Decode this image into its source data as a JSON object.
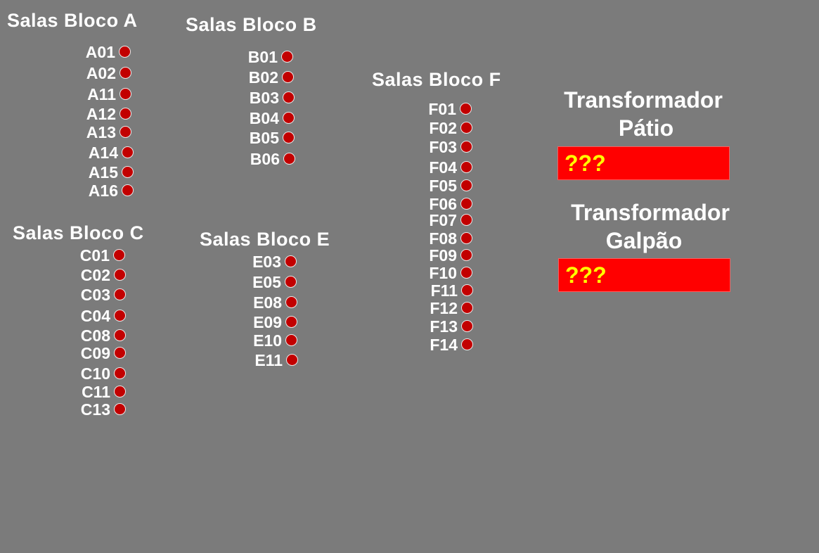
{
  "blocks": {
    "a": {
      "title": "Salas Bloco A",
      "rooms": [
        "A01",
        "A02",
        "A11",
        "A12",
        "A13",
        "A14",
        "A15",
        "A16"
      ]
    },
    "b": {
      "title": "Salas Bloco B",
      "rooms": [
        "B01",
        "B02",
        "B03",
        "B04",
        "B05",
        "B06"
      ]
    },
    "c": {
      "title": "Salas Bloco C",
      "rooms": [
        "C01",
        "C02",
        "C03",
        "C04",
        "C08",
        "C09",
        "C10",
        "C11",
        "C13"
      ]
    },
    "e": {
      "title": "Salas Bloco E",
      "rooms": [
        "E03",
        "E05",
        "E08",
        "E09",
        "E10",
        "E11"
      ]
    },
    "f": {
      "title": "Salas Bloco F",
      "rooms": [
        "F01",
        "F02",
        "F03",
        "F04",
        "F05",
        "F06",
        "F07",
        "F08",
        "F09",
        "F10",
        "F11",
        "F12",
        "F13",
        "F14"
      ]
    }
  },
  "transformers": {
    "patio": {
      "title_line1": "Transformador",
      "title_line2": "Pátio",
      "value": "???"
    },
    "galpao": {
      "title_line1": "Transformador",
      "title_line2": "Galpão",
      "value": "???"
    }
  },
  "colors": {
    "background": "#7b7b7b",
    "status_indicator": "#c20000",
    "transformer_box": "#ff0000",
    "transformer_value": "#ffff00"
  },
  "icons": {
    "room_status": "red-circle-status-icon"
  }
}
